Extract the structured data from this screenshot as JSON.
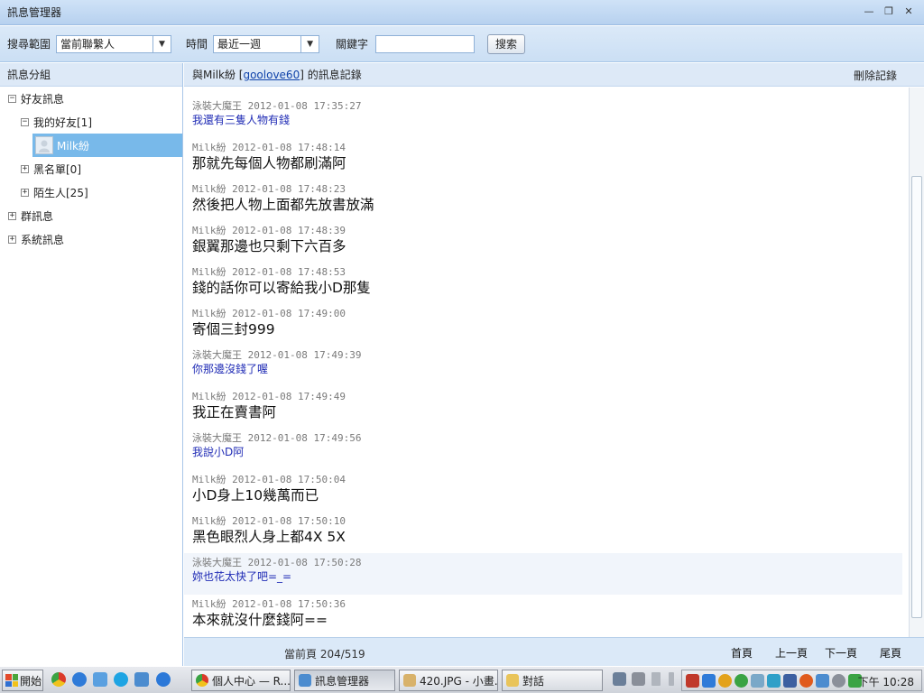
{
  "window": {
    "title": "訊息管理器",
    "controls": [
      "—",
      "❐",
      "✕"
    ]
  },
  "search": {
    "range_label": "搜尋範圍",
    "range_value": "當前聯繫人",
    "time_label": "時間",
    "time_value": "最近一週",
    "keyword_label": "關鍵字",
    "keyword_value": "",
    "button": "搜索"
  },
  "sidebar": {
    "header": "訊息分組",
    "friends": "好友訊息",
    "my_friends": "我的好友[1]",
    "contact": "Milk紛",
    "blacklist": "黑名單[0]",
    "strangers": "陌生人[25]",
    "groups": "群訊息",
    "system": "系統訊息"
  },
  "conversation": {
    "prefix": "與Milk紛 [",
    "user_id": "goolove60",
    "suffix": "] 的訊息記錄",
    "delete": "刪除記錄"
  },
  "messages": [
    {
      "sender": "泳裝大魔王",
      "time": "2012-01-08 17:35:27",
      "text": "我還有三隻人物有錢",
      "self": true
    },
    {
      "sender": "Milk紛",
      "time": "2012-01-08 17:48:14",
      "text": "那就先每個人物都刷滿阿",
      "self": false
    },
    {
      "sender": "Milk紛",
      "time": "2012-01-08 17:48:23",
      "text": "然後把人物上面都先放書放滿",
      "self": false
    },
    {
      "sender": "Milk紛",
      "time": "2012-01-08 17:48:39",
      "text": "銀翼那邊也只剩下六百多",
      "self": false
    },
    {
      "sender": "Milk紛",
      "time": "2012-01-08 17:48:53",
      "text": "錢的話你可以寄給我小D那隻",
      "self": false
    },
    {
      "sender": "Milk紛",
      "time": "2012-01-08 17:49:00",
      "text": "寄個三封999",
      "self": false
    },
    {
      "sender": "泳裝大魔王",
      "time": "2012-01-08 17:49:39",
      "text": "你那邊沒錢了喔",
      "self": true
    },
    {
      "sender": "Milk紛",
      "time": "2012-01-08 17:49:49",
      "text": "我正在賣書阿",
      "self": false
    },
    {
      "sender": "泳裝大魔王",
      "time": "2012-01-08 17:49:56",
      "text": "我說小D阿",
      "self": true
    },
    {
      "sender": "Milk紛",
      "time": "2012-01-08 17:50:04",
      "text": "小D身上10幾萬而已",
      "self": false
    },
    {
      "sender": "Milk紛",
      "time": "2012-01-08 17:50:10",
      "text": "黑色眼烈人身上都4X 5X",
      "self": false
    },
    {
      "sender": "泳裝大魔王",
      "time": "2012-01-08 17:50:28",
      "text": "妳也花太快了吧=_=",
      "self": true
    },
    {
      "sender": "Milk紛",
      "time": "2012-01-08 17:50:36",
      "text": "本來就沒什麼錢阿==",
      "self": false
    }
  ],
  "footer": {
    "page_info": "當前頁 204/519",
    "first": "首頁",
    "prev": "上一頁",
    "next": "下一頁",
    "last": "尾頁"
  },
  "taskbar": {
    "start": "開始",
    "tasks": [
      "個人中心 — R...",
      "訊息管理器",
      "420.JPG - 小畫...",
      "對話"
    ],
    "clock": "下午 10:28"
  }
}
